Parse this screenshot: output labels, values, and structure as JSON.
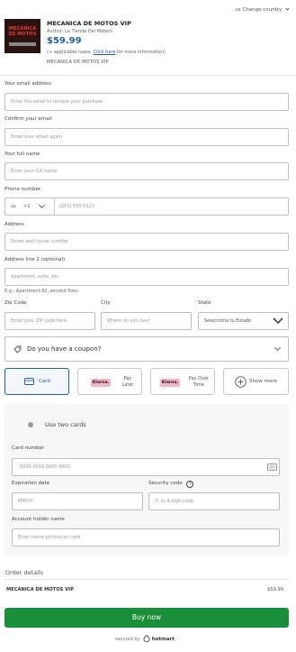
{
  "header": {
    "country_code": "us",
    "change_country": "Change country"
  },
  "product": {
    "thumb_text": "MECANICA DE MOTOS",
    "title": "MECANICA DE MOTOS VIP",
    "author": "Author: La Tienda Del Motero",
    "price": "$59.99",
    "taxes_prefix": "(+ applicable taxes.",
    "taxes_link": "Click here",
    "taxes_suffix": "for more information)",
    "subtitle": "MECANICA DE MOTOS VIP"
  },
  "form": {
    "email_label": "Your email address",
    "email_placeholder": "Enter the email to receive your purchase",
    "confirm_label": "Confirm your email",
    "confirm_placeholder": "Enter your email again",
    "name_label": "Your full name",
    "name_placeholder": "Enter your full name",
    "phone_label": "Phone number",
    "phone_country": "us",
    "phone_code": "+1",
    "phone_placeholder": "(201) 555-0123",
    "address_label": "Address",
    "address_placeholder": "Street and house number",
    "address2_label": "Address line 2 (optional)",
    "address2_placeholder": "Apartment, suite, etc.",
    "address2_hint": "E.g.: Apartment 82, second floor.",
    "zip_label": "Zip Code",
    "zip_placeholder": "Enter your ZIP code here",
    "city_label": "City",
    "city_placeholder": "Where do you live?",
    "state_label": "State",
    "state_value": "Selecciona tu Estado"
  },
  "coupon": {
    "label": "Do you have a coupon?"
  },
  "payment_methods": {
    "card": "Card",
    "klarna_badge": "Klarna.",
    "klarna_pay_later": "Pay Later",
    "klarna_pay_over_time": "Pay Over Time",
    "show_more": "Show more"
  },
  "card_form": {
    "two_cards": "Use two cards",
    "number_label": "Card number",
    "number_placeholder": "0000 0000 0000 0000",
    "expiry_label": "Expiration date",
    "expiry_placeholder": "MM/YY",
    "cvc_label": "Security code",
    "cvc_placeholder": "3- or 4-digit code",
    "holder_label": "Account holder name",
    "holder_placeholder": "Enter name printed on card"
  },
  "order": {
    "heading": "Order details",
    "item_name": "MECANICA DE MOTOS VIP",
    "item_price": "$59.99"
  },
  "actions": {
    "buy": "Buy now"
  },
  "footer": {
    "secured_by": "secured by",
    "brand": "hotmart"
  },
  "colors": {
    "accent": "#1f5fa8",
    "buy_button": "#1a8f3a",
    "klarna_pink": "#f4b6c5"
  },
  "icons": [
    "chevron-down-icon",
    "tag-icon",
    "card-icon",
    "plus-circle-icon",
    "radio-icon",
    "card-brand-icon",
    "question-icon",
    "hotmart-logo-icon"
  ]
}
